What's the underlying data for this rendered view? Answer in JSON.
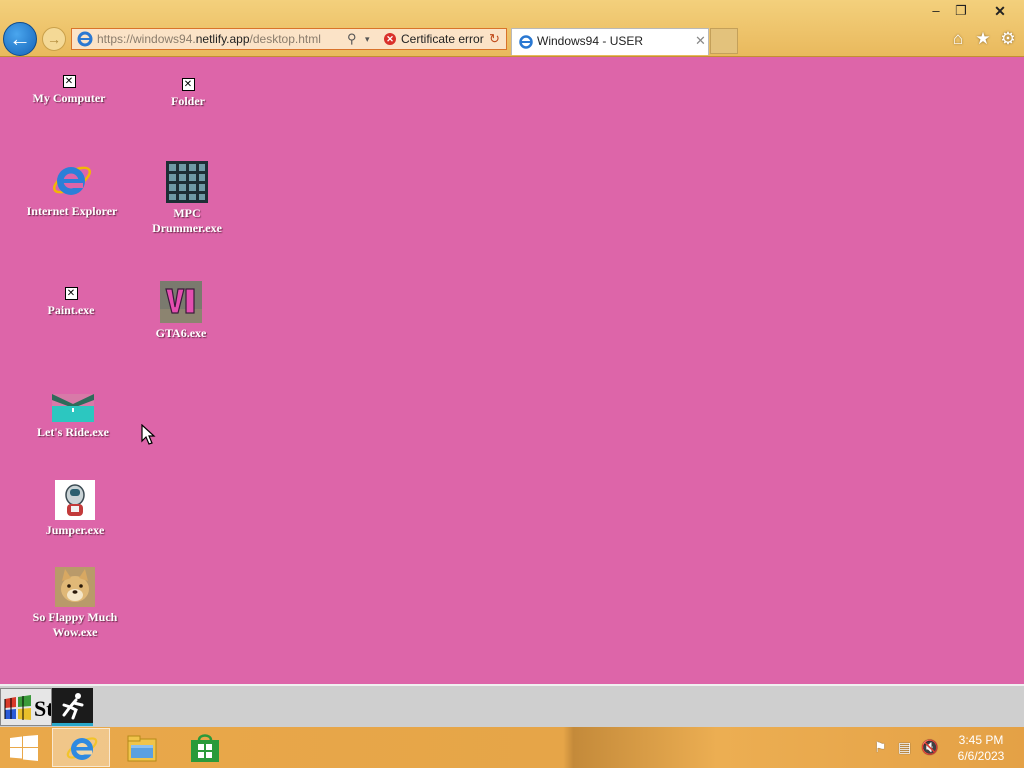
{
  "window_controls": {
    "minimize": "–",
    "restore": "❐",
    "close": "✕"
  },
  "browser": {
    "back_glyph": "←",
    "forward_glyph": "→",
    "address": {
      "url_dim_prefix": "https://windows94.",
      "url_bright": "netlify.app",
      "url_dim_suffix": "/desktop.html",
      "search_glyph": "⚲",
      "dropdown_glyph": "▾",
      "cert_glyph": "✕",
      "cert_text": "Certificate error",
      "refresh_glyph": "↻"
    },
    "tab": {
      "title": "Windows94 - USER",
      "close_glyph": "✕"
    },
    "toolbar": {
      "home_glyph": "⌂",
      "favorites_glyph": "★",
      "tools_glyph": "⚙"
    }
  },
  "desktop": {
    "background": "#dd65a9",
    "broken_glyph": "✕",
    "icons": [
      {
        "label": "My Computer",
        "icon": "broken-image-icon"
      },
      {
        "label": "Folder",
        "icon": "broken-image-icon"
      },
      {
        "label": "Internet Explorer",
        "icon": "internet-explorer-icon"
      },
      {
        "label": "MPC Drummer.exe",
        "icon": "drum-pad-grid-icon"
      },
      {
        "label": "Paint.exe",
        "icon": "broken-image-icon"
      },
      {
        "label": "GTA6.exe",
        "icon": "gta-vi-logo-icon"
      },
      {
        "label": "Let's Ride.exe",
        "icon": "lets-ride-game-icon"
      },
      {
        "label": "Jumper.exe",
        "icon": "jumper-game-icon"
      },
      {
        "label": "So Flappy Much Wow.exe",
        "icon": "doge-icon"
      }
    ]
  },
  "page_bar": {
    "start_text": "St"
  },
  "taskbar": {
    "tray": {
      "flag_glyph": "⚑",
      "network_glyph": "▤",
      "volume_glyph": "🔇"
    },
    "clock": {
      "time": "3:45 PM",
      "date": "6/6/2023"
    }
  }
}
